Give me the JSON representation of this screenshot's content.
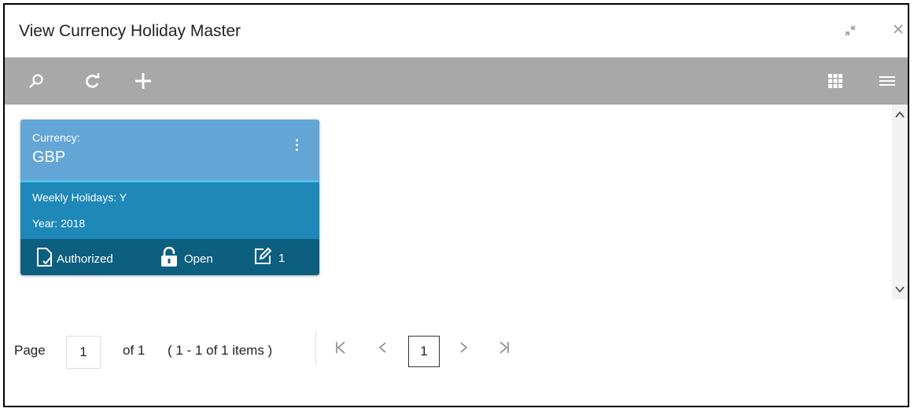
{
  "window": {
    "title": "View Currency Holiday Master"
  },
  "toolbar": {
    "left_icons": [
      "search-icon",
      "refresh-icon",
      "add-icon"
    ],
    "right_icons": [
      "grid-view-icon",
      "list-view-icon"
    ]
  },
  "card": {
    "currency_label": "Currency:",
    "currency_value": "GBP",
    "weekly_holidays": "Weekly Holidays: Y",
    "year": "Year: 2018",
    "status": "Authorized",
    "lock_status": "Open",
    "edit_count": "1"
  },
  "pager": {
    "page_label": "Page",
    "page_value": "1",
    "of_text": "of 1",
    "items_text": "( 1 - 1 of 1 items )",
    "current_page": "1"
  },
  "colors": {
    "toolbar": "#a8a8a8",
    "card_head": "#63a6d6",
    "card_body": "#1e88b8",
    "card_foot": "#0d5f80"
  }
}
